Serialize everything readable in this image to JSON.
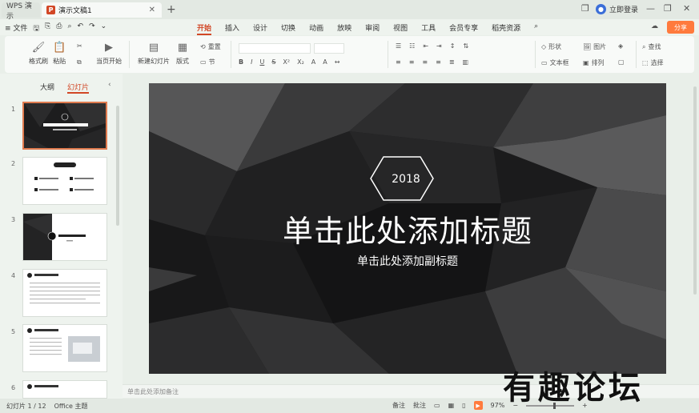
{
  "titlebar": {
    "tab_inactive": "WPS 演示",
    "tab_active": "演示文稿1",
    "login": "立即登录"
  },
  "menubar": {
    "file": "≡ 文件",
    "tabs": [
      "开始",
      "插入",
      "设计",
      "切换",
      "动画",
      "放映",
      "审阅",
      "视图",
      "工具",
      "会员专享",
      "稻壳资源"
    ],
    "share": "分享"
  },
  "ribbon": {
    "format_painter": "格式刷",
    "paste": "粘贴",
    "current_start": "当页开始",
    "new_slide": "新建幻灯片",
    "layout": "版式",
    "reset": "重置",
    "section": "节",
    "shapes": "形状",
    "picture": "图片",
    "textbox": "文本框",
    "arrange": "排列",
    "find": "查找",
    "select": "选择"
  },
  "leftpanel": {
    "tab_outline": "大纲",
    "tab_slides": "幻灯片",
    "thumb_numbers": [
      "1",
      "2",
      "3",
      "4",
      "5",
      "6"
    ]
  },
  "slide": {
    "year": "2018",
    "title": "单击此处添加标题",
    "subtitle": "单击此处添加副标题"
  },
  "notes": {
    "placeholder": "单击此处添加备注"
  },
  "statusbar": {
    "slide_count": "幻灯片 1 / 12",
    "theme": "Office 主题",
    "notes": "备注",
    "comments": "批注",
    "zoom": "97%"
  },
  "watermark": "有趣论坛",
  "colors": {
    "accent": "#d24726",
    "share": "#ff7a3d",
    "slide_bg": "#1b1b1c"
  }
}
